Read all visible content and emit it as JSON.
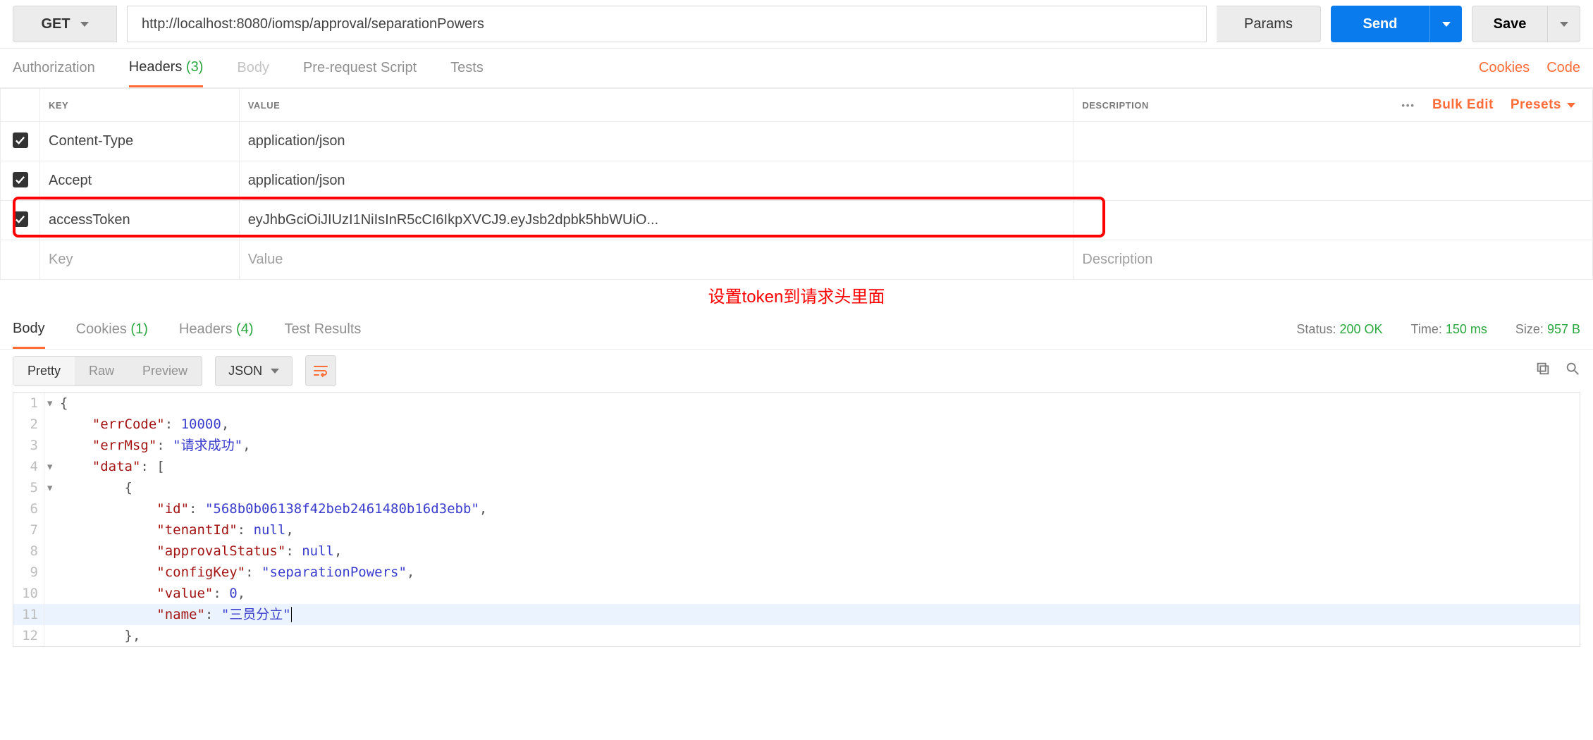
{
  "request": {
    "method": "GET",
    "url": "http://localhost:8080/iomsp/approval/separationPowers",
    "params_label": "Params",
    "send_label": "Send",
    "save_label": "Save"
  },
  "req_tabs": {
    "authorization": "Authorization",
    "headers": "Headers",
    "headers_count": "(3)",
    "body": "Body",
    "prerequest": "Pre-request Script",
    "tests": "Tests",
    "cookies_link": "Cookies",
    "code_link": "Code"
  },
  "headers_table": {
    "col_key": "KEY",
    "col_value": "VALUE",
    "col_desc": "DESCRIPTION",
    "bulk_edit": "Bulk Edit",
    "presets": "Presets",
    "rows": [
      {
        "key": "Content-Type",
        "value": "application/json",
        "enabled": true
      },
      {
        "key": "Accept",
        "value": "application/json",
        "enabled": true
      },
      {
        "key": "accessToken",
        "value": "eyJhbGciOiJIUzI1NiIsInR5cCI6IkpXVCJ9.eyJsb2dpbk5hbWUiO...",
        "enabled": true
      }
    ],
    "placeholder": {
      "key": "Key",
      "value": "Value",
      "desc": "Description"
    }
  },
  "annotation": "设置token到请求头里面",
  "resp_tabs": {
    "body": "Body",
    "cookies": "Cookies",
    "cookies_count": "(1)",
    "headers": "Headers",
    "headers_count": "(4)",
    "test_results": "Test Results"
  },
  "resp_meta": {
    "status_label": "Status:",
    "status_value": "200 OK",
    "time_label": "Time:",
    "time_value": "150 ms",
    "size_label": "Size:",
    "size_value": "957 B"
  },
  "body_toolbar": {
    "pretty": "Pretty",
    "raw": "Raw",
    "preview": "Preview",
    "format": "JSON"
  },
  "json": {
    "errCode_key": "\"errCode\"",
    "errCode_val": "10000",
    "errMsg_key": "\"errMsg\"",
    "errMsg_val": "\"请求成功\"",
    "data_key": "\"data\"",
    "id_key": "\"id\"",
    "id_val": "\"568b0b06138f42beb2461480b16d3ebb\"",
    "tenantId_key": "\"tenantId\"",
    "null_val": "null",
    "approvalStatus_key": "\"approvalStatus\"",
    "configKey_key": "\"configKey\"",
    "configKey_val": "\"separationPowers\"",
    "value_key": "\"value\"",
    "value_val": "0",
    "name_key": "\"name\"",
    "name_val": "\"三员分立\""
  },
  "line_numbers": [
    "1",
    "2",
    "3",
    "4",
    "5",
    "6",
    "7",
    "8",
    "9",
    "10",
    "11",
    "12"
  ]
}
